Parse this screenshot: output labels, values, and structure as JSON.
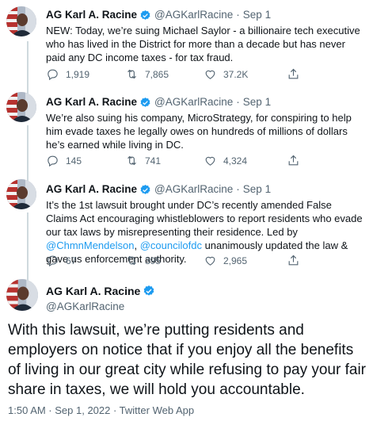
{
  "author": {
    "name": "AG Karl A. Racine",
    "handle": "@AGKarlRacine"
  },
  "separator": "·",
  "tweets": [
    {
      "date": "Sep 1",
      "text": "NEW: Today, we’re suing Michael Saylor - a billionaire tech executive who has lived in the District for more than a decade but has never paid any DC income taxes - for tax fraud.",
      "replies": "1,919",
      "retweets": "7,865",
      "likes": "37.2K"
    },
    {
      "date": "Sep 1",
      "text": "We’re also suing his company, MicroStrategy, for conspiring to help him evade taxes he legally owes on hundreds of millions of dollars he’s earned while living in DC.",
      "replies": "145",
      "retweets": "741",
      "likes": "4,324"
    },
    {
      "date": "Sep 1",
      "text_before": "It’s the 1st lawsuit brought under DC’s recently amended False Claims Act encouraging whistleblowers to report residents who evade our tax laws by misrepresenting their residence. Led by ",
      "mention1": "@ChmnMendelson",
      "text_middle": ", ",
      "mention2": "@councilofdc",
      "text_after": " unanimously updated the law & gave us enforcement authority.",
      "replies": "67",
      "retweets": "395",
      "likes": "2,965"
    }
  ],
  "main_tweet": {
    "text": "With this lawsuit, we’re putting residents and employers on notice that if you enjoy all the benefits of living in our great city while refusing to pay your fair share in taxes, we will hold you accountable.",
    "footer": "1:50 AM · Sep 1, 2022 · Twitter Web App"
  },
  "colors": {
    "link": "#1d9bf0",
    "verified": "#1d9bf0",
    "secondary_text": "#536471",
    "thread_line": "#cfd9de"
  },
  "icons": [
    "verified-badge-icon",
    "reply-icon",
    "retweet-icon",
    "like-icon",
    "share-icon"
  ]
}
